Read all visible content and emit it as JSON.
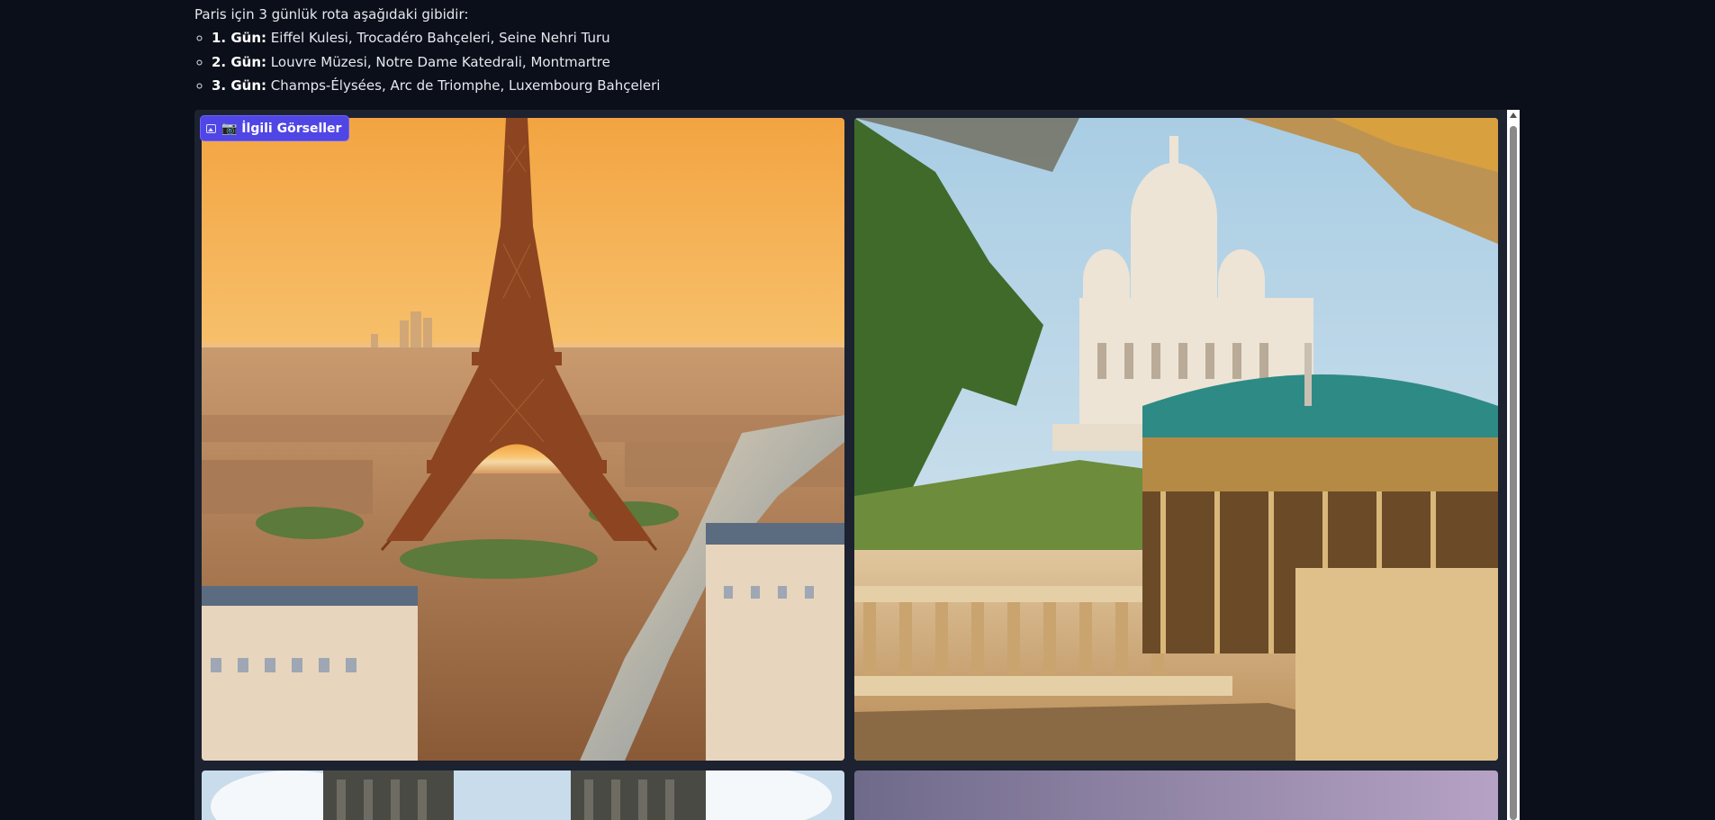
{
  "message": {
    "intro": "Paris için 3 günlük rota aşağıdaki gibidir:",
    "days": [
      {
        "label": "1. Gün:",
        "text": " Eiffel Kulesi, Trocadéro Bahçeleri, Seine Nehri Turu"
      },
      {
        "label": "2. Gün:",
        "text": " Louvre Müzesi, Notre Dame Katedrali, Montmartre"
      },
      {
        "label": "3. Gün:",
        "text": " Champs-Élysées, Arc de Triomphe, Luxembourg Bahçeleri"
      }
    ]
  },
  "gallery": {
    "badge_label": "📷 İlgili Görseller",
    "badge_icon": "image-icon",
    "images": [
      {
        "subject": "eiffel-tower-sunset"
      },
      {
        "subject": "sacre-coeur-carousel"
      },
      {
        "subject": "notre-dame-towers"
      },
      {
        "subject": "paris-dusk-sky"
      }
    ]
  },
  "colors": {
    "background": "#0b0f19",
    "badge": "#4f46e5",
    "panel": "#1c2230"
  }
}
